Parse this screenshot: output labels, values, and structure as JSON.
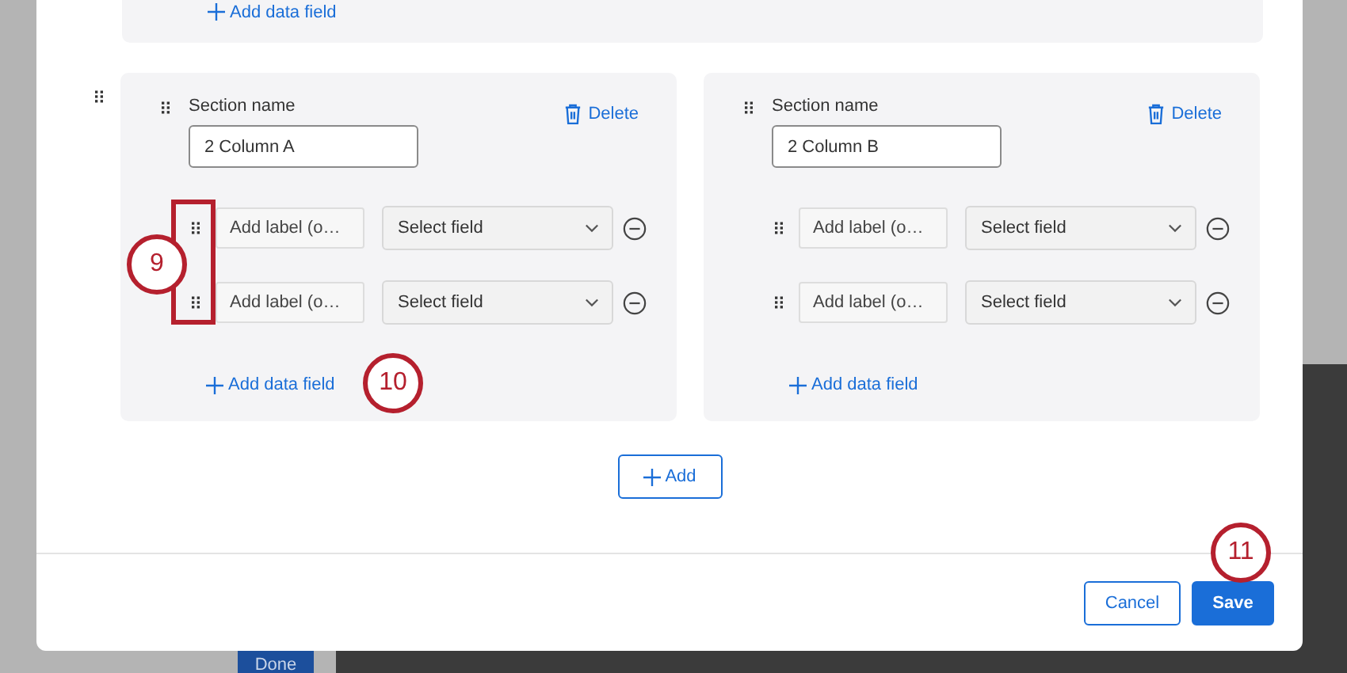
{
  "background": {
    "done_button": "Done"
  },
  "top_section": {
    "add_field_link": "Add data field"
  },
  "sections": [
    {
      "label": "Section name",
      "name": "2 Column A",
      "delete": "Delete",
      "fields": [
        {
          "placeholder": "Add label (o…",
          "select": "Select field"
        },
        {
          "placeholder": "Add label (o…",
          "select": "Select field"
        }
      ],
      "add_field_link": "Add data field"
    },
    {
      "label": "Section name",
      "name": "2 Column B",
      "delete": "Delete",
      "fields": [
        {
          "placeholder": "Add label (o…",
          "select": "Select field"
        },
        {
          "placeholder": "Add label (o…",
          "select": "Select field"
        }
      ],
      "add_field_link": "Add data field"
    }
  ],
  "add_button": "Add",
  "buttons": [
    {
      "label": "Cancel",
      "kind": "secondary"
    },
    {
      "label": "Save",
      "kind": "primary"
    }
  ],
  "callouts": [
    {
      "number": "9",
      "kind": "bracket"
    },
    {
      "number": "10",
      "kind": "circle"
    },
    {
      "number": "11",
      "kind": "circle"
    }
  ]
}
